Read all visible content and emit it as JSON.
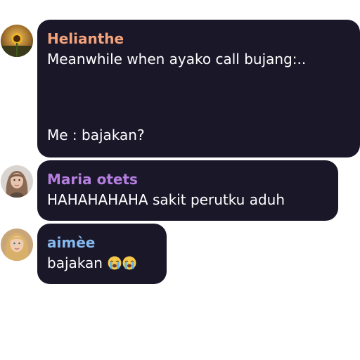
{
  "messages": [
    {
      "author": "Helianthe",
      "author_color": "#f4a37a",
      "lines": [
        "Meanwhile when ayako call bujang:..",
        "Me : bajakan?"
      ],
      "avatar": "sunflower-avatar"
    },
    {
      "author": "Maria otets",
      "author_color": "#b57fe0",
      "lines": [
        "HAHAHAHAHA sakit perutku aduh"
      ],
      "avatar": "woman-avatar"
    },
    {
      "author": "aimèe",
      "author_color": "#86b9ee",
      "lines": [
        "bajakan"
      ],
      "avatar": "blonde-woman-avatar",
      "emojis": [
        "loudly-crying-face-icon",
        "loudly-crying-face-icon"
      ]
    }
  ]
}
